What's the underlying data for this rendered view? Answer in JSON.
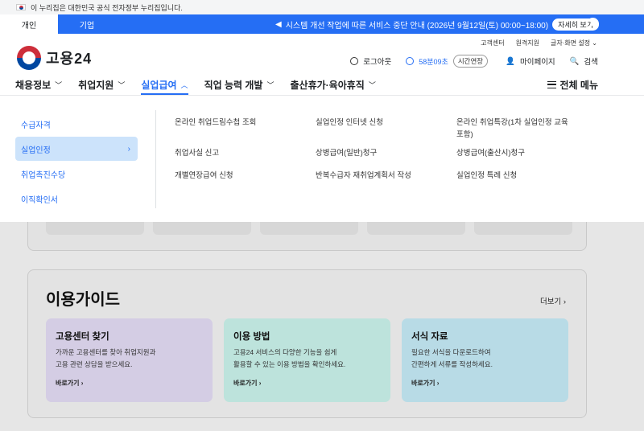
{
  "gov_banner": {
    "text": "이 누리집은 대한민국 공식 전자정부 누리집입니다."
  },
  "audience_tabs": {
    "personal": "개인",
    "corporate": "기업"
  },
  "notice": {
    "text": "시스템 개선 작업에 따른 서비스 중단 안내 (2026년 9월12일(토) 00:00~18:00)",
    "detail_label": "자세히 보기"
  },
  "util_links": [
    "고객센터",
    "원격지원",
    "글자·화면 설정"
  ],
  "logo": {
    "text": "고용24"
  },
  "header": {
    "logout": "로그아웃",
    "timer": "58분09초",
    "extend": "시간연장",
    "mypage": "마이페이지",
    "search": "검색"
  },
  "gnb": {
    "items": [
      "채용정보",
      "취업지원",
      "실업급여",
      "직업 능력 개발",
      "출산휴가·육아휴직"
    ],
    "active_index": 2,
    "all_menu": "전체 메뉴"
  },
  "megamenu": {
    "submenu": [
      "수급자격",
      "실업인정",
      "취업촉진수당",
      "이직확인서"
    ],
    "selected": "실업인정",
    "links": [
      "온라인 취업드림수첩 조회",
      "실업인정 인터넷 신청",
      "온라인 취업특강(1차 실업인정 교육 포함)",
      "취업사실 신고",
      "상병급여(일반)청구",
      "상병급여(출산시)청구",
      "개별연장급여 신청",
      "반복수급자 재취업계획서 작성",
      "실업인정 특례 신청"
    ]
  },
  "guide": {
    "title": "이용가이드",
    "more": "더보기",
    "cards": [
      {
        "title": "고용센터 찾기",
        "desc1": "가까운 고용센터를 찾아 취업지원과",
        "desc2": "고용 관련 상담을 받으세요.",
        "link": "바로가기",
        "color": "#d4cde4"
      },
      {
        "title": "이용 방법",
        "desc1": "고용24 서비스의 다양한 기능을 쉽게",
        "desc2": "활용할 수 있는 이용 방법을 확인하세요.",
        "link": "바로가기",
        "color": "#bde3dc"
      },
      {
        "title": "서식 자료",
        "desc1": "필요한 서식을 다운로드하여",
        "desc2": "간편하게 서류를 작성하세요.",
        "link": "바로가기",
        "color": "#b8dbe6"
      }
    ]
  },
  "colors": {
    "primary": "#256ef4",
    "selected_bg": "#cce3fb",
    "flag_red": "#cd2e3a",
    "flag_blue": "#0047a0"
  }
}
